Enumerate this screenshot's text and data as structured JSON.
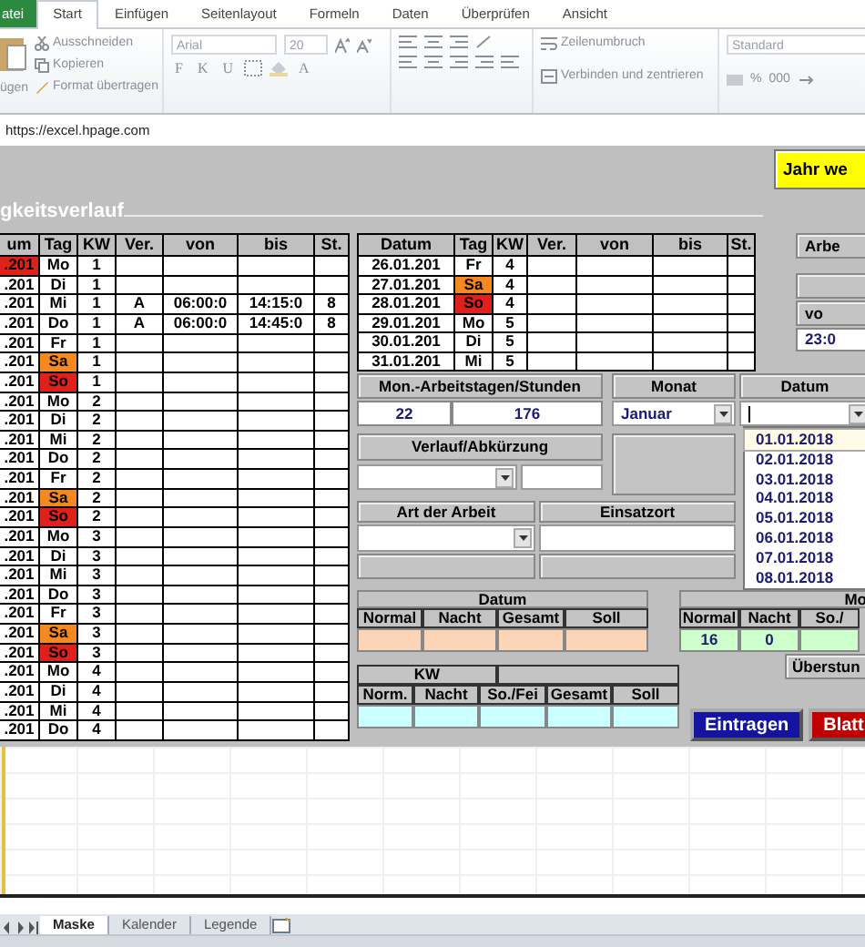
{
  "ribbon": {
    "tabs": [
      {
        "label": "atei",
        "kind": "file",
        "selected": false
      },
      {
        "label": "Start",
        "kind": "tab",
        "selected": true
      },
      {
        "label": "Einfügen",
        "kind": "tab",
        "selected": false
      },
      {
        "label": "Seitenlayout",
        "kind": "tab",
        "selected": false
      },
      {
        "label": "Formeln",
        "kind": "tab",
        "selected": false
      },
      {
        "label": "Daten",
        "kind": "tab",
        "selected": false
      },
      {
        "label": "Überprüfen",
        "kind": "tab",
        "selected": false
      },
      {
        "label": "Ansicht",
        "kind": "tab",
        "selected": false
      }
    ],
    "clipboard": {
      "paste": "ügen",
      "cut": "Ausschneiden",
      "copy": "Kopieren",
      "format": "Format übertragen"
    },
    "font": {
      "name": "Arial",
      "size": "20",
      "styles": [
        "F",
        "K",
        "U"
      ],
      "color_button": "A"
    },
    "alignment": {
      "wrap": "Zeilenumbruch",
      "merge": "Verbinden und zentrieren"
    },
    "number": {
      "format": "Standard",
      "buttons": [
        "%",
        "000"
      ]
    }
  },
  "address": "https://excel.hpage.com",
  "form": {
    "year_button": "Jahr we",
    "title": "gkeitsverlauf",
    "columns": [
      "um",
      "Tag",
      "KW",
      "Ver.",
      "von",
      "bis",
      "St."
    ],
    "rows": [
      {
        "date": {
          "text": ".201",
          "color": "#e0201b"
        },
        "day": {
          "text": "Mo"
        },
        "kw": "1"
      },
      {
        "date": {
          "text": ".201"
        },
        "day": {
          "text": "Di"
        },
        "kw": "1"
      },
      {
        "date": {
          "text": ".201"
        },
        "day": {
          "text": "Mi"
        },
        "kw": "1",
        "ver": "A",
        "von": "06:00:0",
        "bis": "14:15:0",
        "st": "8"
      },
      {
        "date": {
          "text": ".201"
        },
        "day": {
          "text": "Do"
        },
        "kw": "1",
        "ver": "A",
        "von": "06:00:0",
        "bis": "14:45:0",
        "st": "8"
      },
      {
        "date": {
          "text": ".201"
        },
        "day": {
          "text": "Fr"
        },
        "kw": "1"
      },
      {
        "date": {
          "text": ".201"
        },
        "day": {
          "text": "Sa",
          "color": "#f5881f"
        },
        "kw": "1"
      },
      {
        "date": {
          "text": ".201"
        },
        "day": {
          "text": "So",
          "color": "#e0201b"
        },
        "kw": "1"
      },
      {
        "date": {
          "text": ".201"
        },
        "day": {
          "text": "Mo"
        },
        "kw": "2"
      },
      {
        "date": {
          "text": ".201"
        },
        "day": {
          "text": "Di"
        },
        "kw": "2"
      },
      {
        "date": {
          "text": ".201"
        },
        "day": {
          "text": "Mi"
        },
        "kw": "2"
      },
      {
        "date": {
          "text": ".201"
        },
        "day": {
          "text": "Do"
        },
        "kw": "2"
      },
      {
        "date": {
          "text": ".201"
        },
        "day": {
          "text": "Fr"
        },
        "kw": "2"
      },
      {
        "date": {
          "text": ".201"
        },
        "day": {
          "text": "Sa",
          "color": "#f5881f"
        },
        "kw": "2"
      },
      {
        "date": {
          "text": ".201"
        },
        "day": {
          "text": "So",
          "color": "#e0201b"
        },
        "kw": "2"
      },
      {
        "date": {
          "text": ".201"
        },
        "day": {
          "text": "Mo"
        },
        "kw": "3"
      },
      {
        "date": {
          "text": ".201"
        },
        "day": {
          "text": "Di"
        },
        "kw": "3"
      },
      {
        "date": {
          "text": ".201"
        },
        "day": {
          "text": "Mi"
        },
        "kw": "3"
      },
      {
        "date": {
          "text": ".201"
        },
        "day": {
          "text": "Do"
        },
        "kw": "3"
      },
      {
        "date": {
          "text": ".201"
        },
        "day": {
          "text": "Fr"
        },
        "kw": "3"
      },
      {
        "date": {
          "text": ".201"
        },
        "day": {
          "text": "Sa",
          "color": "#f5881f"
        },
        "kw": "3"
      },
      {
        "date": {
          "text": ".201"
        },
        "day": {
          "text": "So",
          "color": "#e0201b"
        },
        "kw": "3"
      },
      {
        "date": {
          "text": ".201"
        },
        "day": {
          "text": "Mo"
        },
        "kw": "4"
      },
      {
        "date": {
          "text": ".201"
        },
        "day": {
          "text": "Di"
        },
        "kw": "4"
      },
      {
        "date": {
          "text": ".201"
        },
        "day": {
          "text": "Mi"
        },
        "kw": "4"
      },
      {
        "date": {
          "text": ".201"
        },
        "day": {
          "text": "Do"
        },
        "kw": "4"
      }
    ],
    "week_table": {
      "columns": [
        "Datum",
        "Tag",
        "KW",
        "Ver.",
        "von",
        "bis",
        "St."
      ],
      "rows": [
        {
          "date": {
            "text": "26.01.201"
          },
          "day": {
            "text": "Fr"
          },
          "kw": "4"
        },
        {
          "date": {
            "text": "27.01.201"
          },
          "day": {
            "text": "Sa",
            "color": "#f5881f"
          },
          "kw": "4"
        },
        {
          "date": {
            "text": "28.01.201"
          },
          "day": {
            "text": "So",
            "color": "#e0201b"
          },
          "kw": "4"
        },
        {
          "date": {
            "text": "29.01.201"
          },
          "day": {
            "text": "Mo"
          },
          "kw": "5"
        },
        {
          "date": {
            "text": "30.01.201"
          },
          "day": {
            "text": "Di"
          },
          "kw": "5"
        },
        {
          "date": {
            "text": "31.01.201"
          },
          "day": {
            "text": "Mi"
          },
          "kw": "5"
        }
      ]
    },
    "side": {
      "button": "Arbe",
      "header": "vo",
      "value": "23:0"
    },
    "monthly": {
      "title": "Mon.-Arbeitstagen/Stunden",
      "days": "22",
      "hours": "176"
    },
    "month": {
      "label": "Monat",
      "value": "Januar"
    },
    "date": {
      "label": "Datum",
      "options": [
        {
          "label": "01.01.2018",
          "selected": true
        },
        {
          "label": "02.01.2018",
          "selected": false
        },
        {
          "label": "03.01.2018",
          "selected": false
        },
        {
          "label": "04.01.2018",
          "selected": false
        },
        {
          "label": "05.01.2018",
          "selected": false
        },
        {
          "label": "06.01.2018",
          "selected": false
        },
        {
          "label": "07.01.2018",
          "selected": false
        },
        {
          "label": "08.01.2018",
          "selected": false
        }
      ]
    },
    "course": {
      "label": "Verlauf/Abkürzung"
    },
    "work_type": {
      "label": "Art der Arbeit"
    },
    "location": {
      "label": "Einsatzort"
    },
    "day_totals": {
      "title": "Datum",
      "columns": [
        "Normal",
        "Nacht",
        "Gesamt",
        "Soll"
      ]
    },
    "month_totals": {
      "title": "Mo",
      "columns": [
        "Normal",
        "Nacht",
        "So./"
      ],
      "values": [
        "16",
        "0"
      ]
    },
    "overtime_button": "Überstun",
    "week_totals": {
      "title": "KW",
      "columns": [
        "Norm.",
        "Nacht",
        "So./Fei",
        "Gesamt",
        "Soll"
      ]
    },
    "buttons": [
      {
        "label": "Eintragen",
        "kind": "primary"
      },
      {
        "label": "Blatt",
        "kind": "danger"
      }
    ]
  },
  "sheet_tabs": [
    {
      "label": "Maske",
      "selected": true
    },
    {
      "label": "Kalender",
      "selected": false
    },
    {
      "label": "Legende",
      "selected": false
    }
  ]
}
